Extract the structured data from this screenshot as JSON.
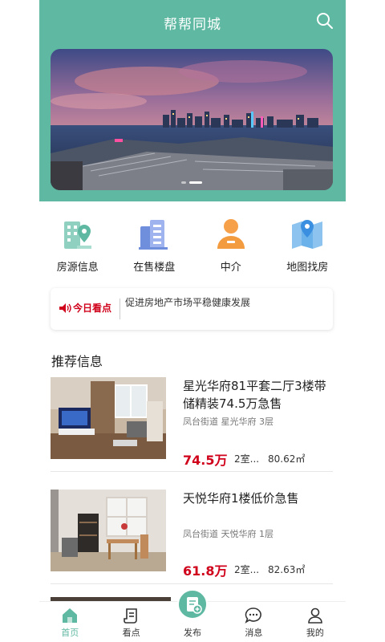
{
  "header": {
    "title": "帮帮同城"
  },
  "banner": {
    "active_index": 1,
    "total": 2
  },
  "categories": [
    {
      "label": "房源信息",
      "icon": "building-pin-icon"
    },
    {
      "label": "在售楼盘",
      "icon": "buildings-icon"
    },
    {
      "label": "中介",
      "icon": "agent-icon"
    },
    {
      "label": "地图找房",
      "icon": "map-pin-icon"
    }
  ],
  "notice": {
    "tag": "今日看点",
    "text": "促进房地产市场平稳健康发展"
  },
  "section": {
    "title": "推荐信息"
  },
  "listings": [
    {
      "title": "星光华府81平套二厅3楼带储精装74.5万急售",
      "location": "凤台街道 星光华府 3层",
      "price": "74.5万",
      "rooms": "2室...",
      "area": "80.62㎡"
    },
    {
      "title": "天悦华府1楼低价急售",
      "location": "凤台街道 天悦华府 1层",
      "price": "61.8万",
      "rooms": "2室...",
      "area": "82.63㎡"
    }
  ],
  "nav": [
    {
      "label": "首页",
      "icon": "home-icon",
      "active": true
    },
    {
      "label": "看点",
      "icon": "news-icon",
      "active": false
    },
    {
      "label": "发布",
      "icon": "publish-icon",
      "active": false
    },
    {
      "label": "消息",
      "icon": "message-icon",
      "active": false
    },
    {
      "label": "我的",
      "icon": "profile-icon",
      "active": false
    }
  ],
  "colors": {
    "brand": "#5fb8a2",
    "price": "#d0021b"
  }
}
